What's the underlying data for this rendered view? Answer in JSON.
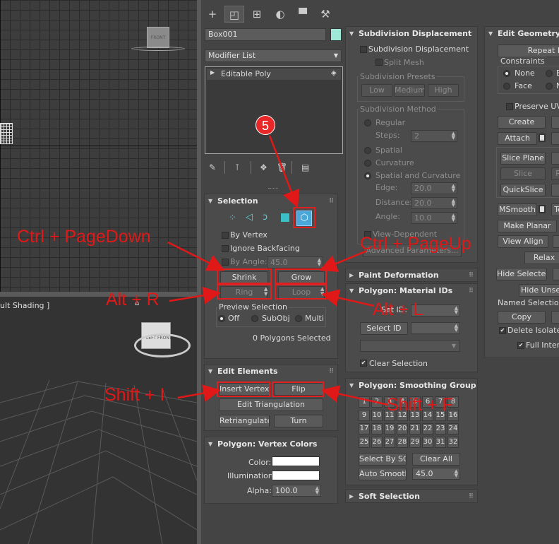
{
  "tabs": [
    "create",
    "modify",
    "hierarchy",
    "motion",
    "display",
    "utilities"
  ],
  "object_name": "Box001",
  "object_color": "#9fe8d8",
  "modifier_list": "Modifier List",
  "stack_item": "Editable Poly",
  "viewport_top": {
    "cube_label": "FRONT"
  },
  "viewport_persp": {
    "label": "ult Shading ]",
    "cube_left": "LEFT",
    "cube_front": "FRONT"
  },
  "selection": {
    "title": "Selection",
    "by_vertex": "By Vertex",
    "ignore_backfacing": "Ignore Backfacing",
    "by_angle": "By Angle:",
    "angle_value": "45.0",
    "shrink": "Shrink",
    "grow": "Grow",
    "ring": "Ring",
    "loop": "Loop",
    "preview_label": "Preview Selection",
    "off": "Off",
    "subobj": "SubObj",
    "multi": "Multi",
    "status": "0 Polygons Selected"
  },
  "edit_elements": {
    "title": "Edit Elements",
    "insert_vertex": "Insert Vertex",
    "flip": "Flip",
    "edit_triangulation": "Edit Triangulation",
    "retriangulate": "Retriangulate",
    "turn": "Turn"
  },
  "vertex_colors": {
    "title": "Polygon: Vertex Colors",
    "color": "Color:",
    "illumination": "Illumination:",
    "alpha": "Alpha:",
    "alpha_value": "100.0"
  },
  "subdivision": {
    "title": "Subdivision Displacement",
    "check": "Subdivision Displacement",
    "split_mesh": "Split Mesh",
    "presets": "Subdivision Presets",
    "low": "Low",
    "medium": "Medium",
    "high": "High",
    "method": "Subdivision Method",
    "regular": "Regular",
    "steps": "Steps:",
    "steps_value": "2",
    "spatial": "Spatial",
    "curvature": "Curvature",
    "spatial_curvature": "Spatial and Curvature",
    "edge": "Edge:",
    "edge_value": "20.0",
    "distance": "Distance:",
    "distance_value": "20.0",
    "angle": "Angle:",
    "angle_value": "10.0",
    "view_dependent": "View-Dependent",
    "advanced": "Advanced Parameters..."
  },
  "paint_deformation": "Paint Deformation",
  "material_ids": {
    "title": "Polygon: Material IDs",
    "set_id": "Set ID:",
    "select_id": "Select ID",
    "clear_selection": "Clear Selection"
  },
  "smoothing": {
    "title": "Polygon: Smoothing Group",
    "groups": [
      "1",
      "2",
      "3",
      "4",
      "5",
      "6",
      "7",
      "8",
      "9",
      "10",
      "11",
      "12",
      "13",
      "14",
      "15",
      "16",
      "17",
      "18",
      "19",
      "20",
      "21",
      "22",
      "23",
      "24",
      "25",
      "26",
      "27",
      "28",
      "29",
      "30",
      "31",
      "32"
    ],
    "select_by_sg": "Select By SG",
    "clear_all": "Clear All",
    "auto_smooth": "Auto Smooth",
    "auto_value": "45.0"
  },
  "soft_selection": "Soft Selection",
  "edit_geometry": {
    "title": "Edit Geometry",
    "repeat_last": "Repeat L",
    "constraints": "Constraints",
    "none": "None",
    "face": "Face",
    "e_trunc": "E",
    "n_trunc": "N",
    "preserve_uvs": "Preserve UVs",
    "create": "Create",
    "attach": "Attach",
    "slice_plane": "Slice Plane",
    "slice": "Slice",
    "r_trunc": "R",
    "quickslice": "QuickSlice",
    "msmooth": "MSmooth",
    "te_trunc": "Te",
    "make_planar": "Make Planar",
    "view_align": "View Align",
    "relax": "Relax",
    "hide_selected": "Hide Selected",
    "hide_unsel": "Hide Unsele",
    "named_selections": "Named Selections",
    "copy": "Copy",
    "delete_isolated": "Delete Isolated",
    "full_interactivity": "Full Intera"
  },
  "annotations": {
    "step": "5",
    "ctrl_pagedown": "Ctrl + PageDown",
    "ctrl_pageup": "Ctrl + PageUp",
    "alt_r": "Alt + R",
    "alt_l": "Alt + L",
    "shift_i": "Shift + I",
    "shift_f": "Shift + F"
  },
  "accent_red": "#e01818"
}
